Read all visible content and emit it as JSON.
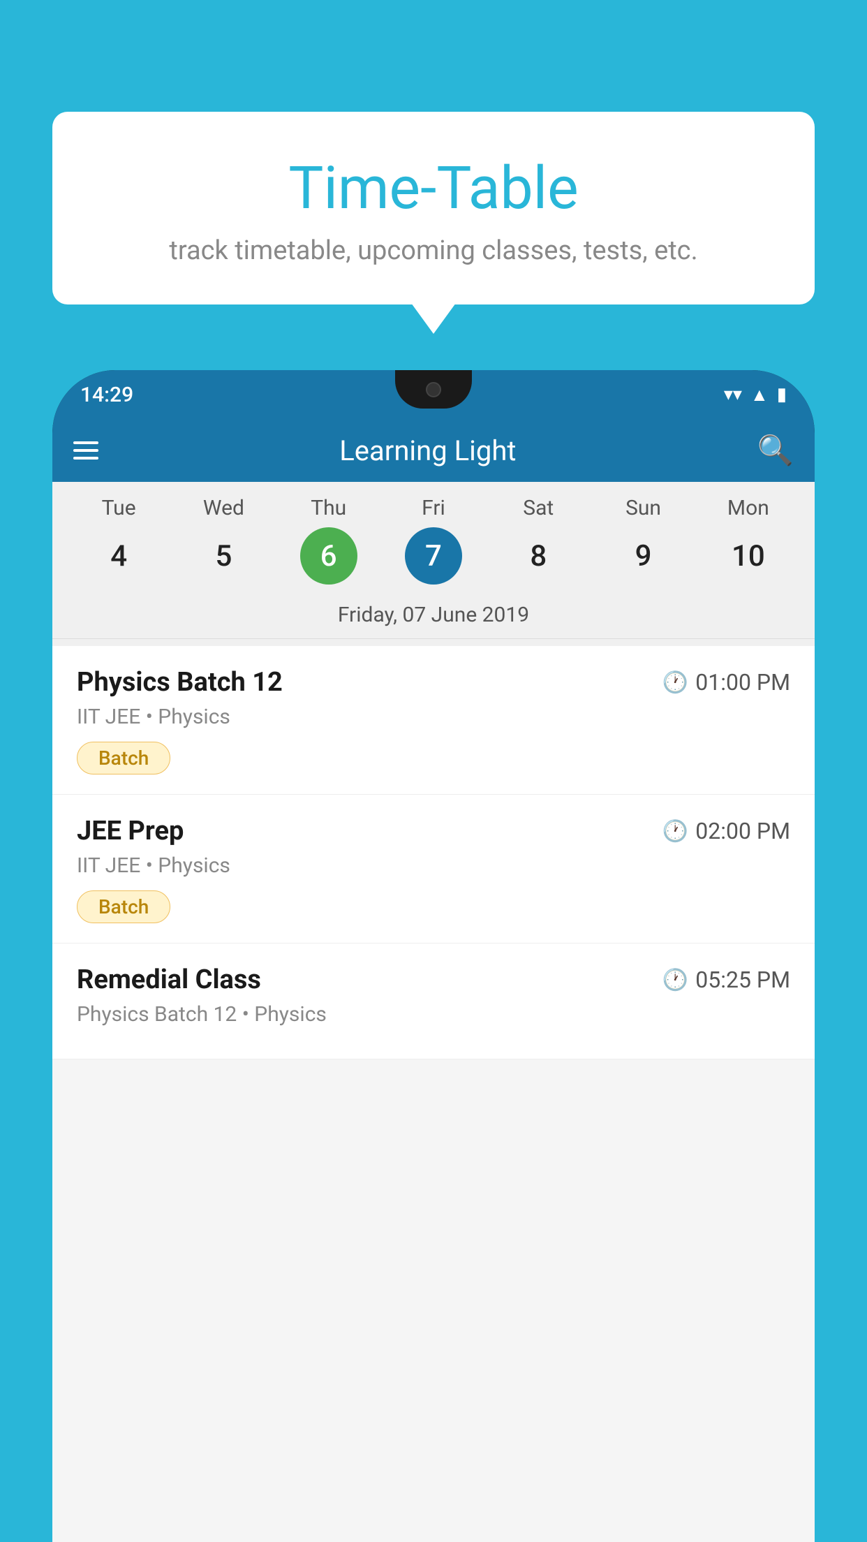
{
  "background_color": "#29B6D8",
  "header": {
    "title": "Time-Table",
    "subtitle": "track timetable, upcoming classes, tests, etc."
  },
  "phone": {
    "status_bar": {
      "time": "14:29"
    },
    "app_bar": {
      "title": "Learning Light"
    },
    "calendar": {
      "days": [
        {
          "name": "Tue",
          "num": "4",
          "state": "normal"
        },
        {
          "name": "Wed",
          "num": "5",
          "state": "normal"
        },
        {
          "name": "Thu",
          "num": "6",
          "state": "today"
        },
        {
          "name": "Fri",
          "num": "7",
          "state": "selected"
        },
        {
          "name": "Sat",
          "num": "8",
          "state": "normal"
        },
        {
          "name": "Sun",
          "num": "9",
          "state": "normal"
        },
        {
          "name": "Mon",
          "num": "10",
          "state": "normal"
        }
      ],
      "selected_date_label": "Friday, 07 June 2019"
    },
    "schedule": [
      {
        "name": "Physics Batch 12",
        "time": "01:00 PM",
        "meta": "IIT JEE • Physics",
        "badge": "Batch"
      },
      {
        "name": "JEE Prep",
        "time": "02:00 PM",
        "meta": "IIT JEE • Physics",
        "badge": "Batch"
      },
      {
        "name": "Remedial Class",
        "time": "05:25 PM",
        "meta": "Physics Batch 12 • Physics",
        "badge": ""
      }
    ]
  },
  "icons": {
    "hamburger": "☰",
    "search": "🔍",
    "clock": "🕐",
    "wifi": "▲",
    "signal": "◂",
    "battery": "▮"
  }
}
